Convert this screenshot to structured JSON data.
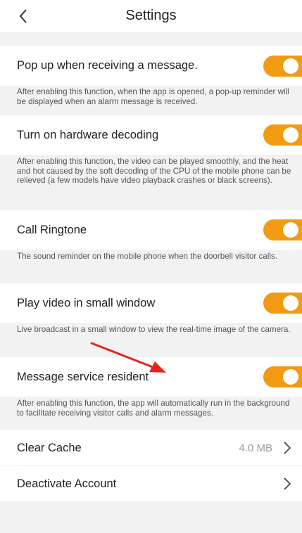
{
  "header": {
    "title": "Settings",
    "back_icon": "chevron-left-icon"
  },
  "colors": {
    "accent": "#f29a12",
    "background": "#f2f2f2",
    "card": "#ffffff"
  },
  "settings": [
    {
      "label": "Pop up when receiving a message.",
      "enabled": true,
      "description": "After enabling this function, when the app is opened, a pop-up reminder will be displayed when an alarm message is received."
    },
    {
      "label": "Turn on hardware decoding",
      "enabled": true,
      "description": "After enabling this function, the video can be played smoothly, and the heat and hot caused by the soft decoding of the CPU of the mobile phone can be relieved (a few models have video playback crashes or black screens)."
    },
    {
      "label": "Call Ringtone",
      "enabled": true,
      "description": "The sound reminder on the mobile phone when the doorbell visitor calls."
    },
    {
      "label": "Play video in small window",
      "enabled": true,
      "description": "Live broadcast in a small window to view the real-time image of the camera."
    },
    {
      "label": "Message service resident",
      "enabled": true,
      "description": "After enabling this function, the app will automatically run in the background to facilitate receiving visitor calls and alarm messages."
    }
  ],
  "clear_cache": {
    "label": "Clear Cache",
    "value": "4.0 MB",
    "icon": "chevron-right-icon"
  },
  "deactivate": {
    "label": "Deactivate Account",
    "icon": "chevron-right-icon"
  },
  "annotation": {
    "icon": "red-arrow-icon"
  }
}
